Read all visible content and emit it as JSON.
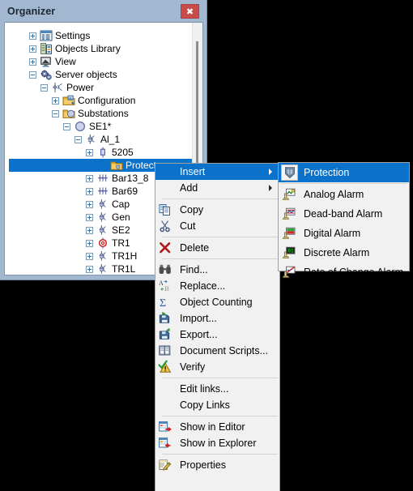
{
  "window": {
    "title": "Organizer",
    "close_label": "✖",
    "close_icon": "close-icon"
  },
  "tree": {
    "items": [
      {
        "label": "Settings",
        "indent": 0,
        "expander": "plus",
        "icon": "settings-grid-icon",
        "selected": false
      },
      {
        "label": "Objects Library",
        "indent": 0,
        "expander": "plus",
        "icon": "objects-library-icon",
        "selected": false
      },
      {
        "label": "View",
        "indent": 0,
        "expander": "plus",
        "icon": "monitor-view-icon",
        "selected": false
      },
      {
        "label": "Server objects",
        "indent": 0,
        "expander": "minus",
        "icon": "server-gears-icon",
        "selected": false
      },
      {
        "label": "Power",
        "indent": 1,
        "expander": "minus",
        "icon": "power-node-icon",
        "selected": false
      },
      {
        "label": "Configuration",
        "indent": 2,
        "expander": "plus",
        "icon": "config-folder-icon",
        "selected": false
      },
      {
        "label": "Substations",
        "indent": 2,
        "expander": "minus",
        "icon": "substations-folder-icon",
        "selected": false
      },
      {
        "label": "SE1*",
        "indent": 3,
        "expander": "minus",
        "icon": "circle-node-icon",
        "selected": false
      },
      {
        "label": "Al_1",
        "indent": 4,
        "expander": "minus",
        "icon": "line-device-icon",
        "selected": false
      },
      {
        "label": "5205",
        "indent": 5,
        "expander": "plus",
        "icon": "breaker-icon",
        "selected": false
      },
      {
        "label": "Protect",
        "indent": 6,
        "expander": "none",
        "icon": "protection-folder-icon",
        "selected": true
      },
      {
        "label": "Bar13_8",
        "indent": 5,
        "expander": "plus",
        "icon": "busbar-icon",
        "selected": false
      },
      {
        "label": "Bar69",
        "indent": 5,
        "expander": "plus",
        "icon": "busbar-icon",
        "selected": false
      },
      {
        "label": "Cap",
        "indent": 5,
        "expander": "plus",
        "icon": "line-device-icon",
        "selected": false
      },
      {
        "label": "Gen",
        "indent": 5,
        "expander": "plus",
        "icon": "line-device-icon",
        "selected": false
      },
      {
        "label": "SE2",
        "indent": 5,
        "expander": "plus",
        "icon": "line-device-icon",
        "selected": false
      },
      {
        "label": "TR1",
        "indent": 5,
        "expander": "plus",
        "icon": "transformer-icon",
        "selected": false
      },
      {
        "label": "TR1H",
        "indent": 5,
        "expander": "plus",
        "icon": "line-device-icon",
        "selected": false
      },
      {
        "label": "TR1L",
        "indent": 5,
        "expander": "plus",
        "icon": "line-device-icon",
        "selected": false
      }
    ],
    "scrollbar": "vertical-scrollbar"
  },
  "context_menu": {
    "items": [
      {
        "type": "item",
        "label": "Insert",
        "icon": "none",
        "submenu": true,
        "highlighted": true
      },
      {
        "type": "item",
        "label": "Add",
        "icon": "none",
        "submenu": true,
        "highlighted": false
      },
      {
        "type": "separator"
      },
      {
        "type": "item",
        "label": "Copy",
        "icon": "copy-icon",
        "submenu": false,
        "highlighted": false
      },
      {
        "type": "item",
        "label": "Cut",
        "icon": "scissors-icon",
        "submenu": false,
        "highlighted": false
      },
      {
        "type": "separator"
      },
      {
        "type": "item",
        "label": "Delete",
        "icon": "delete-x-icon",
        "submenu": false,
        "highlighted": false
      },
      {
        "type": "separator"
      },
      {
        "type": "item",
        "label": "Find...",
        "icon": "binoculars-icon",
        "submenu": false,
        "highlighted": false
      },
      {
        "type": "item",
        "label": "Replace...",
        "icon": "replace-icon",
        "submenu": false,
        "highlighted": false
      },
      {
        "type": "item",
        "label": "Object Counting",
        "icon": "sigma-icon",
        "submenu": false,
        "highlighted": false
      },
      {
        "type": "item",
        "label": "Import...",
        "icon": "import-icon",
        "submenu": false,
        "highlighted": false
      },
      {
        "type": "item",
        "label": "Export...",
        "icon": "export-icon",
        "submenu": false,
        "highlighted": false
      },
      {
        "type": "item",
        "label": "Document Scripts...",
        "icon": "book-icon",
        "submenu": false,
        "highlighted": false
      },
      {
        "type": "item",
        "label": "Verify",
        "icon": "verify-warning-icon",
        "submenu": false,
        "highlighted": false
      },
      {
        "type": "separator"
      },
      {
        "type": "item",
        "label": "Edit links...",
        "icon": "none",
        "submenu": false,
        "highlighted": false
      },
      {
        "type": "item",
        "label": "Copy Links",
        "icon": "none",
        "submenu": false,
        "highlighted": false
      },
      {
        "type": "separator"
      },
      {
        "type": "item",
        "label": "Show in Editor",
        "icon": "show-editor-icon",
        "submenu": false,
        "highlighted": false
      },
      {
        "type": "item",
        "label": "Show in Explorer",
        "icon": "show-explorer-icon",
        "submenu": false,
        "highlighted": false
      },
      {
        "type": "separator"
      },
      {
        "type": "item",
        "label": "Properties",
        "icon": "properties-icon",
        "submenu": false,
        "highlighted": false
      }
    ]
  },
  "submenu": {
    "parent": "Insert",
    "items": [
      {
        "type": "item",
        "label": "Protection",
        "icon": "shield-protection-icon",
        "highlighted": true
      },
      {
        "type": "separator"
      },
      {
        "type": "item",
        "label": "Analog Alarm",
        "icon": "analog-alarm-icon",
        "highlighted": false
      },
      {
        "type": "item",
        "label": "Dead-band Alarm",
        "icon": "deadband-alarm-icon",
        "highlighted": false
      },
      {
        "type": "item",
        "label": "Digital Alarm",
        "icon": "digital-alarm-icon",
        "highlighted": false
      },
      {
        "type": "item",
        "label": "Discrete Alarm",
        "icon": "discrete-alarm-icon",
        "highlighted": false
      },
      {
        "type": "item",
        "label": "Rate of Change Alarm",
        "icon": "rate-change-alarm-icon",
        "highlighted": false
      }
    ]
  },
  "colors": {
    "highlight": "#0a72ca",
    "titlebar": "#a2b8d0",
    "close_button": "#c84c4c",
    "menu_bg": "#f1f1f1",
    "backdrop": "#000000"
  }
}
